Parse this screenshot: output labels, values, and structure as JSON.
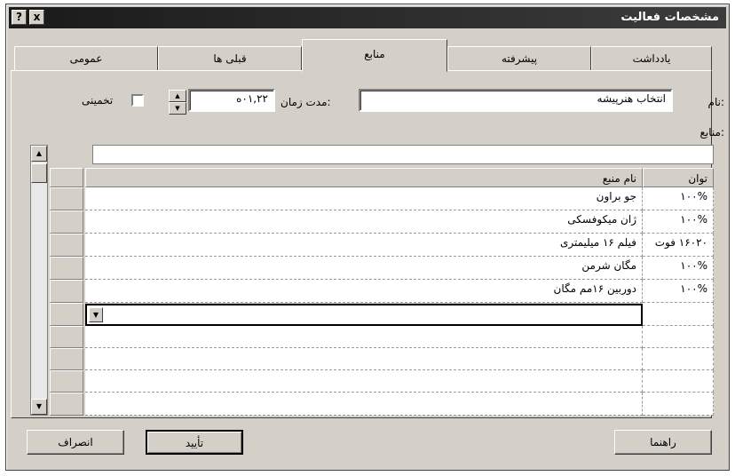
{
  "window": {
    "title": "مشخصات فعالیت",
    "help_label": "?",
    "close_label": "x"
  },
  "tabs": [
    {
      "label": "یادداشت"
    },
    {
      "label": "پیشرفته"
    },
    {
      "label": "منابع"
    },
    {
      "label": "قبلی ها"
    },
    {
      "label": "عمومی"
    }
  ],
  "active_tab": "منابع",
  "form": {
    "name_label": "نام:",
    "name_value": "انتخاب هنرپیشه",
    "duration_label": "مدت زمان:",
    "duration_value": "۰۱,۲۲ه",
    "estimated_label": "تخمینی",
    "estimated_checked": false,
    "resources_label": "منابع:"
  },
  "grid": {
    "columns": [
      "توان",
      "نام منبع"
    ],
    "rows": [
      {
        "units": "۱۰۰%",
        "name": "جو براون"
      },
      {
        "units": "۱۰۰%",
        "name": "ژان میکوفسکی"
      },
      {
        "units": "۱۶۰۲۰ فوت",
        "name": "فیلم ۱۶ میلیمتری"
      },
      {
        "units": "۱۰۰%",
        "name": "مگان شرمن"
      },
      {
        "units": "۱۰۰%",
        "name": "دوربین ۱۶مم مگان"
      }
    ]
  },
  "buttons": {
    "help": "راهنما",
    "ok": "تأیید",
    "cancel": "انصراف"
  },
  "icons": {
    "spin_up": "▲",
    "spin_down": "▼",
    "scroll_up": "▲",
    "scroll_down": "▼",
    "dropdown": "▼"
  }
}
